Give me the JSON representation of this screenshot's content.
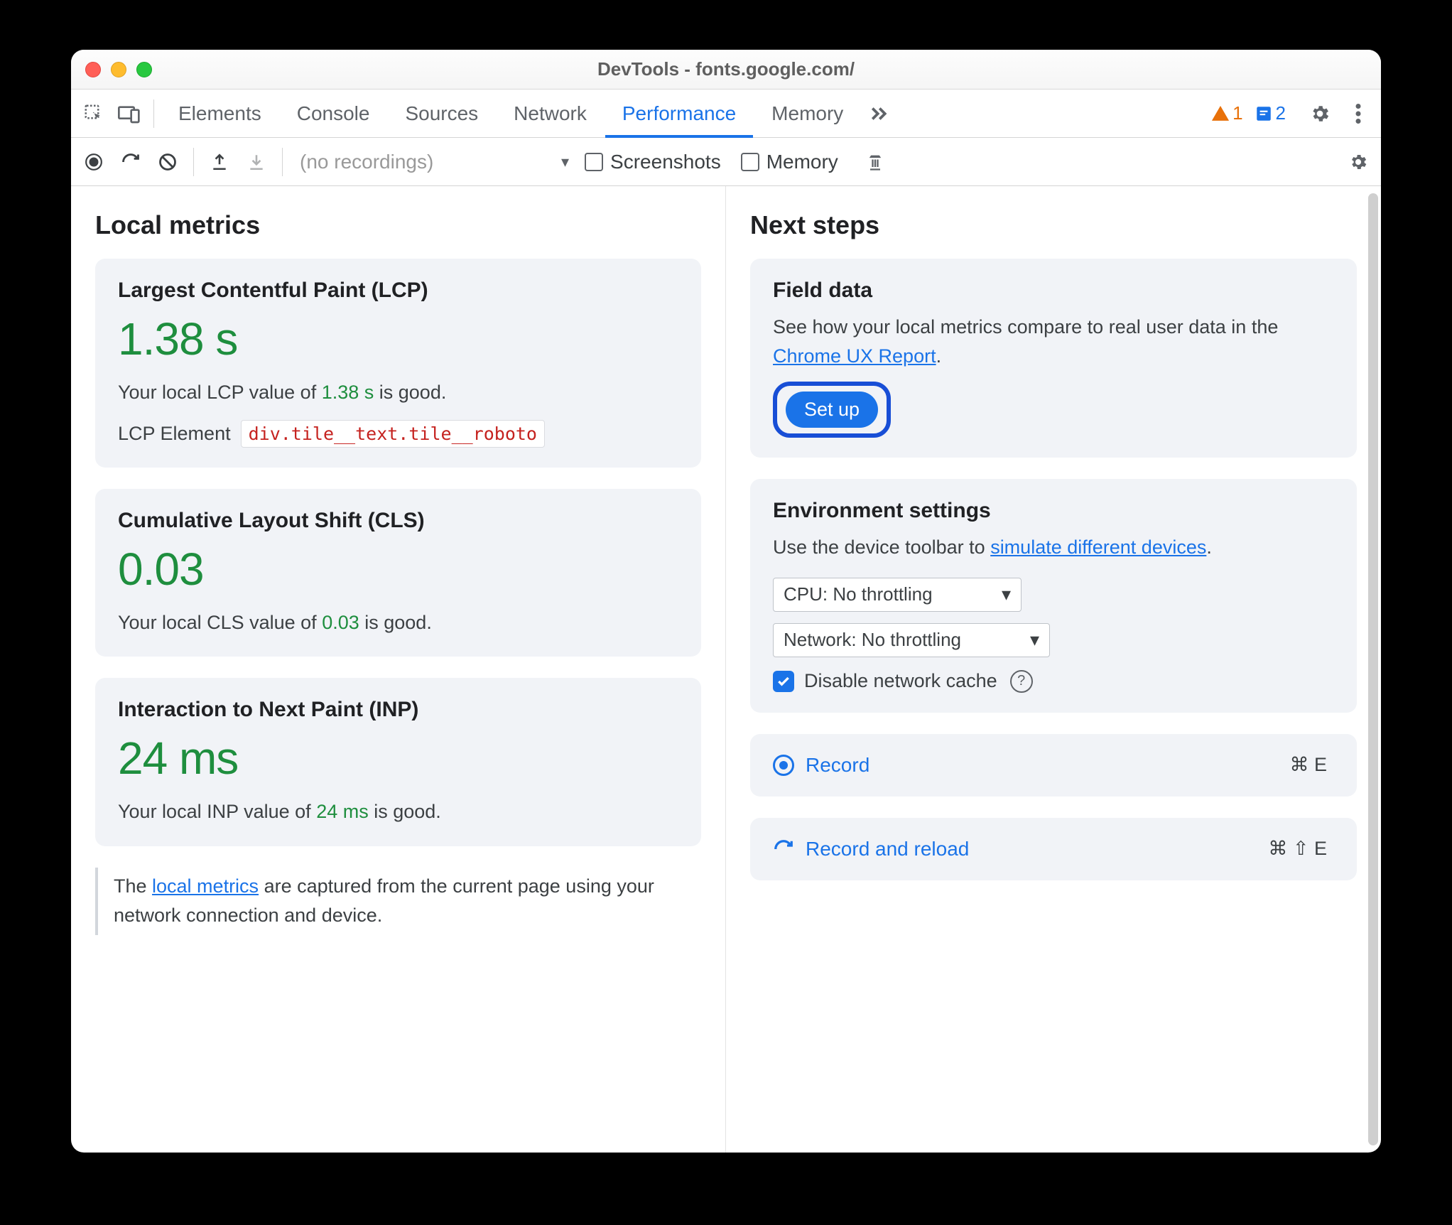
{
  "window": {
    "title": "DevTools - fonts.google.com/"
  },
  "tabs": {
    "items": [
      "Elements",
      "Console",
      "Sources",
      "Network",
      "Performance",
      "Memory"
    ],
    "active_index": 4
  },
  "badges": {
    "warnings": "1",
    "issues": "2"
  },
  "toolbar": {
    "placeholder": "(no recordings)",
    "screenshots_label": "Screenshots",
    "memory_label": "Memory"
  },
  "left": {
    "heading": "Local metrics",
    "lcp": {
      "title": "Largest Contentful Paint (LCP)",
      "value": "1.38 s",
      "desc_pre": "Your local LCP value of ",
      "desc_val": "1.38 s",
      "desc_post": " is good.",
      "element_label": "LCP Element",
      "element_selector": "div.tile__text.tile__roboto"
    },
    "cls": {
      "title": "Cumulative Layout Shift (CLS)",
      "value": "0.03",
      "desc_pre": "Your local CLS value of ",
      "desc_val": "0.03",
      "desc_post": " is good."
    },
    "inp": {
      "title": "Interaction to Next Paint (INP)",
      "value": "24 ms",
      "desc_pre": "Your local INP value of ",
      "desc_val": "24 ms",
      "desc_post": " is good."
    },
    "note_pre": "The ",
    "note_link": "local metrics",
    "note_post": " are captured from the current page using your network connection and device."
  },
  "right": {
    "heading": "Next steps",
    "field": {
      "title": "Field data",
      "desc_pre": "See how your local metrics compare to real user data in the ",
      "desc_link": "Chrome UX Report",
      "desc_post": ".",
      "button": "Set up"
    },
    "env": {
      "title": "Environment settings",
      "desc_pre": "Use the device toolbar to ",
      "desc_link": "simulate different devices",
      "desc_post": ".",
      "cpu_select": "CPU: No throttling",
      "net_select": "Network: No throttling",
      "disable_cache": "Disable network cache"
    },
    "record": {
      "label": "Record",
      "shortcut": "⌘ E"
    },
    "reload": {
      "label": "Record and reload",
      "shortcut": "⌘ ⇧ E"
    }
  }
}
